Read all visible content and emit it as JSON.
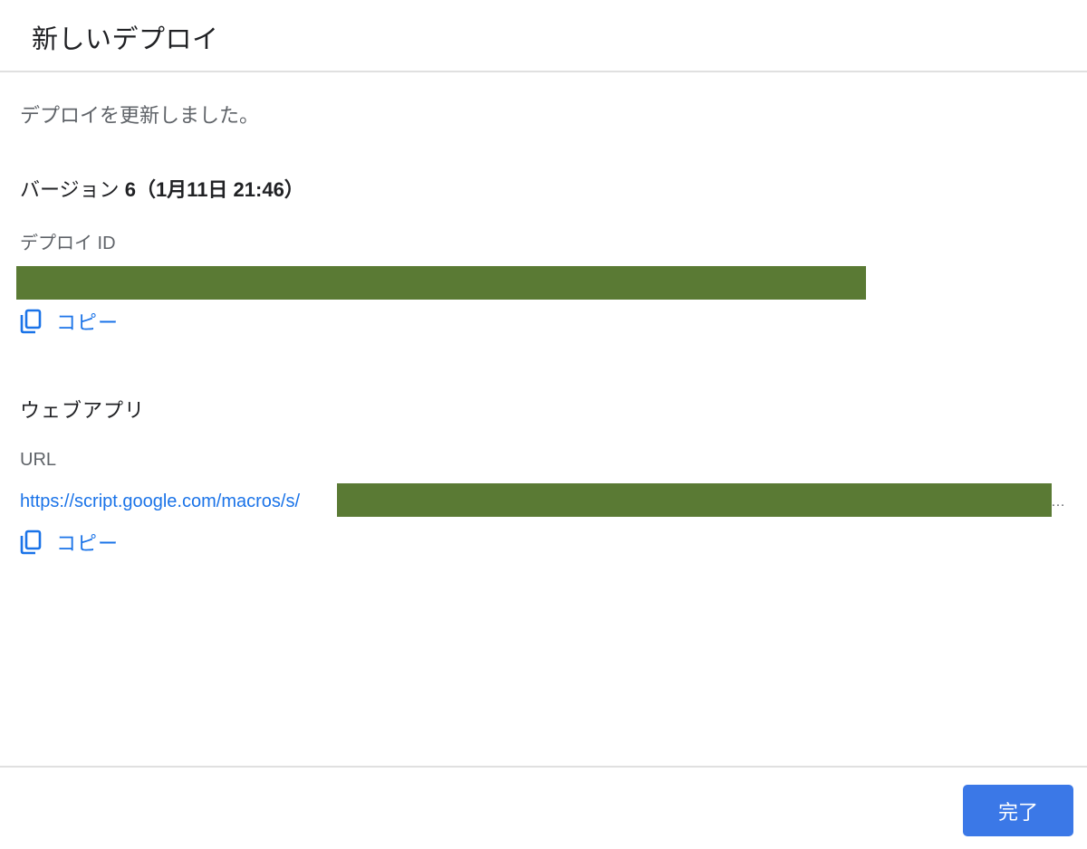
{
  "dialog": {
    "title": "新しいデプロイ",
    "status_message": "デプロイを更新しました。",
    "version": {
      "label": "バージョン",
      "number": "6",
      "timestamp": "（1月11日 21:46）"
    },
    "deploy_id": {
      "label": "デプロイ ID",
      "value_redacted": true,
      "copy_label": "コピー"
    },
    "web_app": {
      "section_title": "ウェブアプリ",
      "url_label": "URL",
      "url_prefix": "https://script.google.com/macros/s/",
      "url_redacted": true,
      "ellipsis": "…",
      "copy_label": "コピー"
    },
    "done_label": "完了"
  },
  "colors": {
    "accent": "#1a73e8",
    "button": "#3b78e7",
    "redaction": "#5a7a34",
    "divider": "#e0e0e0"
  },
  "icons": {
    "copy": "copy-icon"
  }
}
